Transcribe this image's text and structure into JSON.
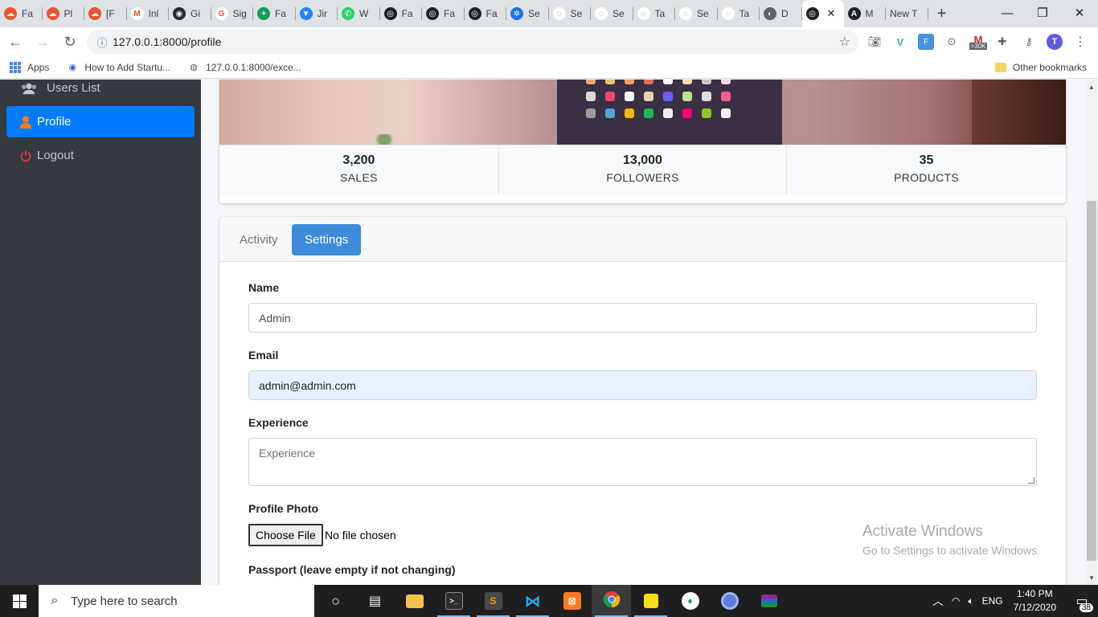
{
  "browser": {
    "tabs": [
      {
        "title": "Fa",
        "color": "#e4572e",
        "glyph": "☁"
      },
      {
        "title": "Pl",
        "color": "#e4572e",
        "glyph": "☁"
      },
      {
        "title": "[F",
        "color": "#e4572e",
        "glyph": "☁"
      },
      {
        "title": "Inl",
        "color": "#ffffff",
        "glyph": "M"
      },
      {
        "title": "Gi",
        "color": "#24292e",
        "glyph": "◉"
      },
      {
        "title": "Sig",
        "color": "#ffffff",
        "glyph": "G"
      },
      {
        "title": "Fa",
        "color": "#0f9d58",
        "glyph": "+"
      },
      {
        "title": "Jir",
        "color": "#2684ff",
        "glyph": "▼"
      },
      {
        "title": "W",
        "color": "#25d366",
        "glyph": "✆"
      },
      {
        "title": "Fa",
        "color": "#202124",
        "glyph": "◎"
      },
      {
        "title": "Fa",
        "color": "#202124",
        "glyph": "◎"
      },
      {
        "title": "Fa",
        "color": "#202124",
        "glyph": "◎"
      },
      {
        "title": "Se",
        "color": "#1a73e8",
        "glyph": "✲"
      },
      {
        "title": "Se",
        "color": "#ffffff",
        "glyph": "◌"
      },
      {
        "title": "Se",
        "color": "#ffffff",
        "glyph": "◌"
      },
      {
        "title": "Ta",
        "color": "#ffffff",
        "glyph": "◌"
      },
      {
        "title": "Se",
        "color": "#ffffff",
        "glyph": "◌"
      },
      {
        "title": "Ta",
        "color": "#ffffff",
        "glyph": "◌"
      },
      {
        "title": "D",
        "color": "#5f6368",
        "glyph": "◐"
      },
      {
        "title": "",
        "color": "#202124",
        "glyph": "◎",
        "active": true
      },
      {
        "title": "M",
        "color": "#202124",
        "glyph": "A"
      },
      {
        "title": "New T",
        "color": "",
        "glyph": ""
      }
    ],
    "tab_close": "✕",
    "new_tab": "+",
    "window": {
      "minimize": "—",
      "maximize": "❐",
      "close": "✕"
    },
    "url": "127.0.0.1:8000/profile",
    "bookmarks": [
      {
        "label": "Apps",
        "icon": "apps-grid-icon"
      },
      {
        "label": "How to Add Startu...",
        "icon": "globe-icon"
      },
      {
        "label": "127.0.0.1:8000/exce...",
        "icon": "globe-icon"
      }
    ],
    "other_bookmarks": "Other bookmarks",
    "profile_initial": "T",
    "gmail_badge": ">30K"
  },
  "sidebar": {
    "items": [
      {
        "label": "Users List",
        "icon": "users-icon"
      },
      {
        "label": "Profile",
        "icon": "user-icon",
        "active": true
      },
      {
        "label": "Logout",
        "icon": "power-icon"
      }
    ]
  },
  "profile": {
    "stats": [
      {
        "value": "3,200",
        "label": "SALES"
      },
      {
        "value": "13,000",
        "label": "FOLLOWERS"
      },
      {
        "value": "35",
        "label": "PRODUCTS"
      }
    ]
  },
  "tabs": {
    "activity": "Activity",
    "settings": "Settings"
  },
  "form": {
    "name_label": "Name",
    "name_value": "Admin",
    "email_label": "Email",
    "email_value": "admin@admin.com",
    "experience_label": "Experience",
    "experience_placeholder": "Experience",
    "photo_label": "Profile Photo",
    "choose_file": "Choose File",
    "no_file": "No file chosen",
    "password_label": "Passport (leave empty if not changing)"
  },
  "watermark": {
    "line1": "Activate Windows",
    "line2": "Go to Settings to activate Windows."
  },
  "taskbar": {
    "search_placeholder": "Type here to search",
    "language": "ENG",
    "time": "1:40 PM",
    "date": "7/12/2020",
    "notifications": "38"
  },
  "colors": {
    "primary": "#007bff",
    "sidebar_bg": "#343a40",
    "settings_tab": "#3d8bd9"
  }
}
